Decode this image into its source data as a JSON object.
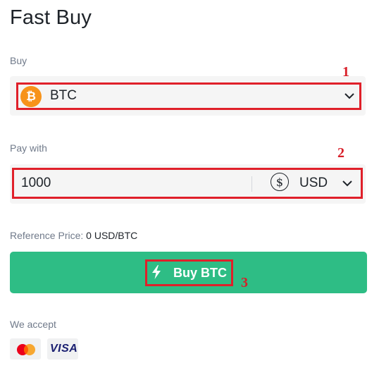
{
  "page": {
    "title": "Fast Buy"
  },
  "buy": {
    "label": "Buy",
    "coin": "BTC",
    "coin_icon": "bitcoin-icon",
    "coin_icon_glyph": "₿",
    "coin_color": "#f7931a"
  },
  "pay": {
    "label": "Pay with",
    "amount": "1000",
    "currency": "USD",
    "currency_icon": "dollar-icon",
    "currency_glyph": "$"
  },
  "reference": {
    "label": "Reference Price: ",
    "value": "0 USD/BTC"
  },
  "action": {
    "label": "Buy BTC",
    "icon": "lightning-icon",
    "color": "#2ebd85"
  },
  "payment_methods": {
    "label": "We accept",
    "cards": [
      "mastercard",
      "VISA"
    ]
  },
  "annotations": {
    "color": "#e0202a",
    "markers": [
      "1",
      "2",
      "3"
    ]
  }
}
